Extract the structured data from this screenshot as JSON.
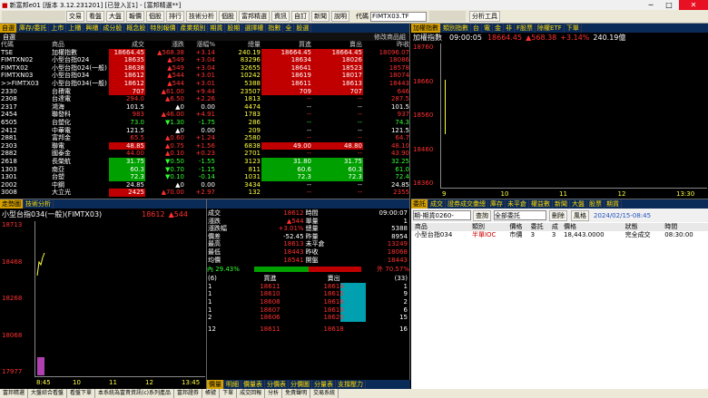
{
  "window": {
    "title": "新富邦e01 [版本 3.12.231201] [已登入][1] - [富邦精選**]",
    "min": "─",
    "max": "□",
    "close": "✕"
  },
  "toolbar": {
    "items": [
      "交易",
      "看盤",
      "大盤",
      "報價",
      "個股",
      "排行",
      "技術分析",
      "個股",
      "富邦精選",
      "資訊",
      "自訂",
      "新聞",
      "說明"
    ],
    "code_label": "代碼",
    "code_value": "FIMTX03.TF",
    "analysis": "分析工具"
  },
  "quote_panel": {
    "tabs": [
      "自選",
      "庫存/委託",
      "上市",
      "上櫃",
      "興櫃",
      "成分股",
      "概念股",
      "特別報價",
      "產業類別",
      "期貨",
      "股期",
      "選擇權",
      "指數",
      "全",
      "股選"
    ],
    "sort_label": "自選",
    "sort_extra": "修改商品組",
    "headers": [
      "代碼",
      "商品",
      "成交",
      "漲跌",
      "漲幅%",
      "總量",
      "買進",
      "賣出",
      "昨收"
    ],
    "rows": [
      {
        "code": "TSE",
        "name": "加權指數",
        "price": "18664.45",
        "chg": "▲568.38",
        "pct": "+3.14",
        "vol": "240.19",
        "bid": "18664.45",
        "ask": "18664.45",
        "prev": "18096.07",
        "c": "red",
        "hl": "rbg"
      },
      {
        "code": "FIMTXN02",
        "name": "小型台指024",
        "price": "18635",
        "chg": "▲549",
        "pct": "+3.04",
        "vol": "83296",
        "bid": "18634",
        "ask": "18026",
        "prev": "18086",
        "c": "red",
        "hl": "rbg"
      },
      {
        "code": "FIMTX02",
        "name": "小型台指024(一般)",
        "price": "18638",
        "chg": "▲549",
        "pct": "+3.04",
        "vol": "32655",
        "bid": "18641",
        "ask": "18523",
        "prev": "18578",
        "c": "red",
        "hl": "rbg"
      },
      {
        "code": "FIMTXN03",
        "name": "小型台指034",
        "price": "18612",
        "chg": "▲544",
        "pct": "+3.01",
        "vol": "10242",
        "bid": "18619",
        "ask": "18017",
        "prev": "18074",
        "c": "red",
        "hl": "rbg"
      },
      {
        "code": ">>FIMTX03",
        "name": "小型台指034(一般)",
        "price": "18612",
        "chg": "▲544",
        "pct": "+3.01",
        "vol": "5388",
        "bid": "18611",
        "ask": "18613",
        "prev": "18443",
        "c": "red",
        "hl": "rbg"
      },
      {
        "code": "2330",
        "name": "台積電",
        "price": "707",
        "chg": "▲61.00",
        "pct": "+9.44",
        "vol": "23507",
        "bid": "709",
        "ask": "707",
        "prev": "646",
        "c": "red",
        "hl": "rbg"
      },
      {
        "code": "2308",
        "name": "台達電",
        "price": "294.0",
        "chg": "▲6.50",
        "pct": "+2.26",
        "vol": "1813",
        "bid": "--",
        "ask": "--",
        "prev": "287.5",
        "c": "red",
        "hl": ""
      },
      {
        "code": "2317",
        "name": "鴻海",
        "price": "101.5",
        "chg": "▲0",
        "pct": "0.00",
        "vol": "4474",
        "bid": "--",
        "ask": "--",
        "prev": "101.5",
        "c": "wht",
        "hl": ""
      },
      {
        "code": "2454",
        "name": "聯發科",
        "price": "983",
        "chg": "▲46.00",
        "pct": "+4.91",
        "vol": "1783",
        "bid": "--",
        "ask": "--",
        "prev": "937",
        "c": "red",
        "hl": ""
      },
      {
        "code": "6505",
        "name": "台塑化",
        "price": "73.0",
        "chg": "▼1.30",
        "pct": "-1.75",
        "vol": "286",
        "bid": "--",
        "ask": "--",
        "prev": "74.3",
        "c": "grn",
        "hl": ""
      },
      {
        "code": "2412",
        "name": "中華電",
        "price": "121.5",
        "chg": "▲0",
        "pct": "0.00",
        "vol": "209",
        "bid": "--",
        "ask": "--",
        "prev": "121.5",
        "c": "wht",
        "hl": ""
      },
      {
        "code": "2881",
        "name": "富邦金",
        "price": "65.5",
        "chg": "▲0.60",
        "pct": "+1.24",
        "vol": "2580",
        "bid": "--",
        "ask": "--",
        "prev": "64.7",
        "c": "red",
        "hl": ""
      },
      {
        "code": "2303",
        "name": "聯電",
        "price": "48.85",
        "chg": "▲0.75",
        "pct": "+1.56",
        "vol": "6838",
        "bid": "49.00",
        "ask": "48.80",
        "prev": "48.10",
        "c": "red",
        "hl": "rbg"
      },
      {
        "code": "2882",
        "name": "國泰金",
        "price": "44.00",
        "chg": "▲0.10",
        "pct": "+0.23",
        "vol": "2701",
        "bid": "--",
        "ask": "--",
        "prev": "43.90",
        "c": "red",
        "hl": ""
      },
      {
        "code": "2618",
        "name": "長榮航",
        "price": "31.75",
        "chg": "▼0.50",
        "pct": "-1.55",
        "vol": "3123",
        "bid": "31.80",
        "ask": "31.75",
        "prev": "32.25",
        "c": "grn",
        "hl": "gbg"
      },
      {
        "code": "1303",
        "name": "南亞",
        "price": "60.3",
        "chg": "▼0.70",
        "pct": "-1.15",
        "vol": "811",
        "bid": "60.6",
        "ask": "60.3",
        "prev": "61.0",
        "c": "grn",
        "hl": "gbg"
      },
      {
        "code": "1301",
        "name": "台塑",
        "price": "72.3",
        "chg": "▼0.10",
        "pct": "-0.14",
        "vol": "1031",
        "bid": "72.3",
        "ask": "72.3",
        "prev": "72.4",
        "c": "grn",
        "hl": "gbg"
      },
      {
        "code": "2002",
        "name": "中鋼",
        "price": "24.85",
        "chg": "▲0",
        "pct": "0.00",
        "vol": "3434",
        "bid": "--",
        "ask": "--",
        "prev": "24.85",
        "c": "wht",
        "hl": ""
      },
      {
        "code": "3008",
        "name": "大立光",
        "price": "2425",
        "chg": "▲70.00",
        "pct": "+2.97",
        "vol": "132",
        "bid": "--",
        "ask": "--",
        "prev": "2355",
        "c": "red",
        "hl": "rbg"
      }
    ]
  },
  "index_panel": {
    "tabs": [
      "加權指數",
      "類別指數",
      "台",
      "電",
      "金",
      "非",
      "F股票",
      "除權ETF",
      "下單"
    ],
    "name": "加權指數",
    "time": "09:00:05",
    "price": "18664.45",
    "chg": "▲568.38",
    "pct": "+3.14%",
    "vol": "240.19億",
    "y_labels": [
      "18760",
      "18660",
      "18560",
      "18460",
      "18360"
    ],
    "x_labels": [
      "9",
      "10",
      "11",
      "12",
      "13:30"
    ]
  },
  "min_chart": {
    "tabs": [
      "走勢圖",
      "技術分析"
    ],
    "name": "小型台指034(一般)(FIMTX03)",
    "price": "18612",
    "chg": "▲544",
    "y_labels": [
      "18713",
      "18468",
      "18268",
      "18068",
      "17977"
    ],
    "x_labels": [
      "8:45",
      "10",
      "11",
      "12",
      "13:45"
    ]
  },
  "detail": {
    "rows": [
      [
        "成交",
        "18612",
        "時間",
        "09:00:07"
      ],
      [
        "漲跌",
        "▲544",
        "單量",
        "1"
      ],
      [
        "漲跌幅",
        "+3.01%",
        "總量",
        "5388"
      ],
      [
        "價差",
        "-52.45",
        "昨量",
        "8954"
      ],
      [
        "最高",
        "18613",
        "未平倉",
        "13249"
      ],
      [
        "最低",
        "18443",
        "昨收",
        "18068"
      ],
      [
        "均價",
        "18541",
        "開盤",
        "18443"
      ]
    ],
    "in_pct": "內 29.43%",
    "out_pct": "外 70.57%",
    "book_head": [
      "(6)",
      "買進",
      "賣出",
      "(33)"
    ],
    "book": [
      [
        "1",
        "18611",
        "18614",
        "1"
      ],
      [
        "1",
        "18610",
        "18615",
        "9"
      ],
      [
        "1",
        "18608",
        "18616",
        "2"
      ],
      [
        "1",
        "18607",
        "18619",
        "6"
      ],
      [
        "2",
        "18606",
        "18620",
        "15"
      ]
    ],
    "book_total": [
      "12",
      "18611",
      "18618",
      "16"
    ],
    "bottom_tabs": [
      "價量",
      "明細",
      "價量表",
      "分價表",
      "分價圖",
      "分量表",
      "支撐壓力"
    ]
  },
  "order_panel": {
    "tabs": [
      "委託",
      "成交",
      "證券成交彙總",
      "庫存",
      "未平倉",
      "權益數",
      "新聞",
      "大盤",
      "股票",
      "期貨"
    ],
    "market": "期-期貨0260-",
    "query": "查詢",
    "filter": "全部委託",
    "delete": "刪除",
    "change": "風格",
    "date": "2024/02/15-08:45",
    "headers": [
      "",
      "商品",
      "類別",
      "價格",
      "委託",
      "成",
      "價格",
      "狀態",
      "時間"
    ],
    "row": [
      "",
      "小型台指034",
      "半單IOC",
      "市價",
      "3",
      "3",
      "18,443.0000",
      "完全成交",
      "08:30:00"
    ]
  },
  "statusbar": [
    "富邦精選",
    "大盤綜合看盤",
    "看盤下單",
    "本系統為富貴資訊(c)系列產品",
    "富邦證券",
    "帳號",
    "下單",
    "成交回報",
    "分析",
    "免責聲明",
    "交易系統"
  ]
}
